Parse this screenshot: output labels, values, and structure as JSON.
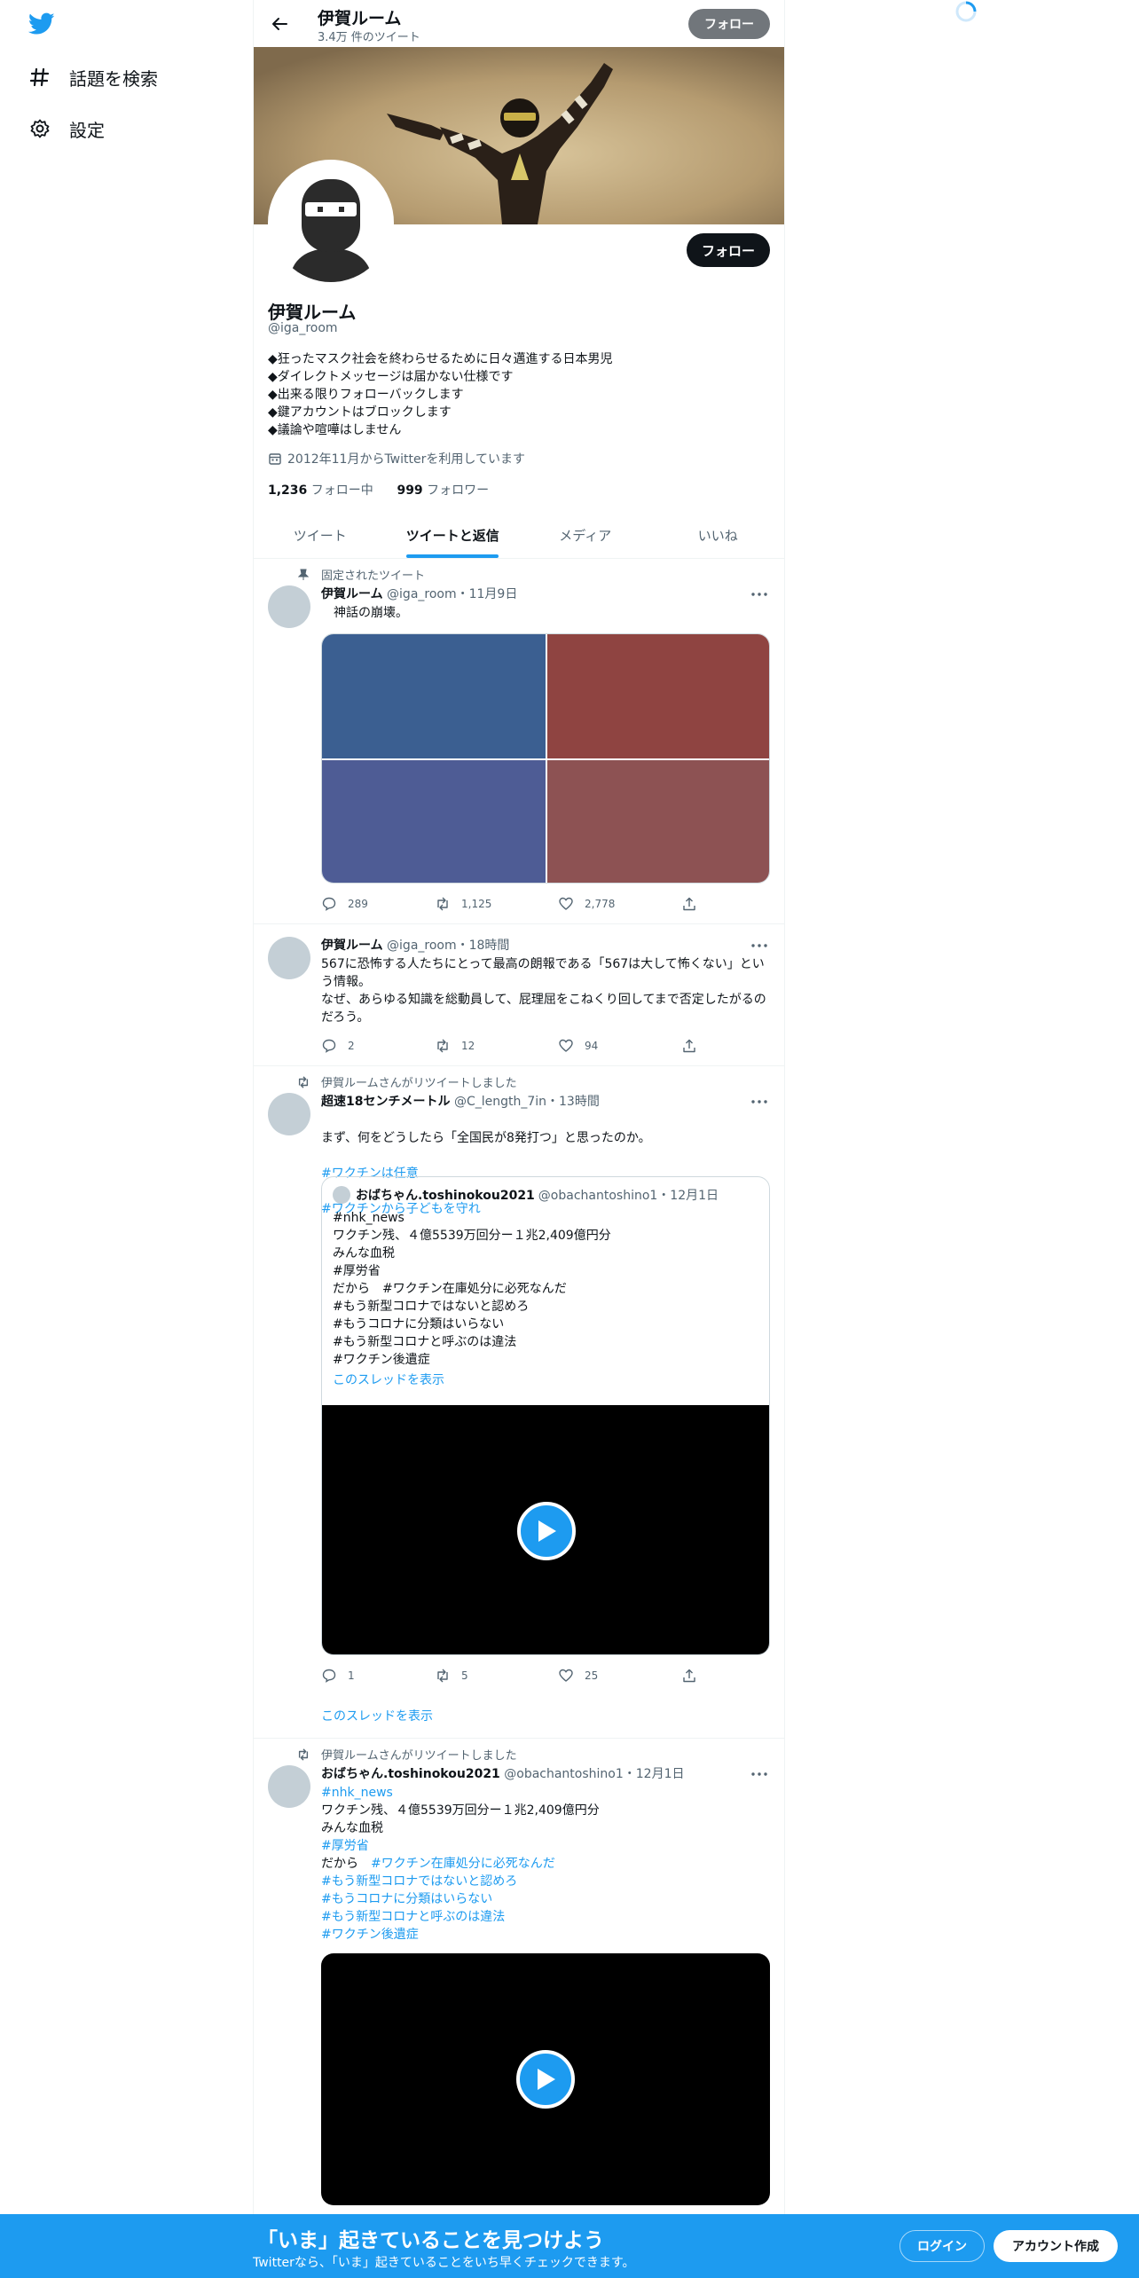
{
  "nav": {
    "logo": "twitter-bird-icon",
    "explore_label": "話題を検索",
    "settings_label": "設定"
  },
  "topbar": {
    "name": "伊賀ルーム",
    "count": "3.4万 件のツイート",
    "follow": "フォロー"
  },
  "profile": {
    "name": "伊賀ルーム",
    "handle": "@iga_room",
    "follow": "フォロー",
    "bio": "◆狂ったマスク社会を終わらせるために日々邁進する日本男児\n◆ダイレクトメッセージは届かない仕様です\n◆出来る限りフォローバックします\n◆鍵アカウントはブロックします\n◆議論や喧嘩はしません",
    "joined": "2012年11月からTwitterを利用しています",
    "following_count": "1,236",
    "following_label": "フォロー中",
    "followers_count": "999",
    "followers_label": "フォロワー"
  },
  "tabs": [
    {
      "label": "ツイート"
    },
    {
      "label": "ツイートと返信",
      "active": true
    },
    {
      "label": "メディア"
    },
    {
      "label": "いいね"
    }
  ],
  "tweets": [
    {
      "context": "固定されたツイート",
      "name": "伊賀ルーム",
      "meta": "@iga_room・11月9日",
      "text": "　神話の崩壊。",
      "replies": "289",
      "retweets": "1,125",
      "likes": "2,778",
      "media_colors": [
        "#3b5f91",
        "#8f4441",
        "#4e5c95",
        "#8d5253"
      ]
    },
    {
      "name": "伊賀ルーム",
      "meta": "@iga_room・18時間",
      "text": "567に恐怖する人たちにとって最高の朗報である「567は大して怖くない」という情報。\nなぜ、あらゆる知識を総動員して、屁理屈をこねくり回してまで否定したがるのだろう。",
      "replies": "2",
      "retweets": "12",
      "likes": "94"
    },
    {
      "context": "伊賀ルームさんがリツイートしました",
      "name": "超速18センチメートル",
      "meta": "@C_length_7in・13時間",
      "text": "まず、何をどうしたら「全国民が8発打つ」と思ったのか。",
      "tags": [
        "#ワクチンは任意",
        "#ワクチンから子どもを守れ"
      ],
      "quote": {
        "name": "おばちゃん.toshinokou2021",
        "meta": "@obachantoshino1・12月1日",
        "text": "#nhk_news\nワクチン残、４億5539万回分ー１兆2,409億円分\nみんな血税\n#厚労省\nだから　#ワクチン在庫処分に必死なんだ\n#もう新型コロナではないと認めろ\n#もうコロナに分類はいらない\n#もう新型コロナと呼ぶのは違法\n#ワクチン後遺症",
        "show_thread": "このスレッドを表示"
      },
      "replies": "1",
      "retweets": "5",
      "likes": "25",
      "show_thread": "このスレッドを表示"
    },
    {
      "context": "伊賀ルームさんがリツイートしました",
      "name": "おばちゃん.toshinokou2021",
      "meta": "@obachantoshino1・12月1日",
      "line1": "#nhk_news",
      "line2": "ワクチン残、４億5539万回分ー１兆2,409億円分",
      "line3": "みんな血税",
      "line4": "#厚労省",
      "line5_plain": "だから　",
      "line5_tag": "#ワクチン在庫処分に必死なんだ",
      "line6": "#もう新型コロナではないと認めろ",
      "line7": "#もうコロナに分類はいらない",
      "line8": "#もう新型コロナと呼ぶのは違法",
      "line9": "#ワクチン後遺症"
    }
  ],
  "bottom": {
    "title": "「いま」起きていることを見つけよう",
    "subtitle": "Twitterなら、「いま」起きていることをいち早くチェックできます。",
    "login": "ログイン",
    "signup": "アカウント作成"
  },
  "colors": {
    "accent": "#1d9bf0",
    "dark": "#0f1419",
    "muted": "#536471"
  }
}
